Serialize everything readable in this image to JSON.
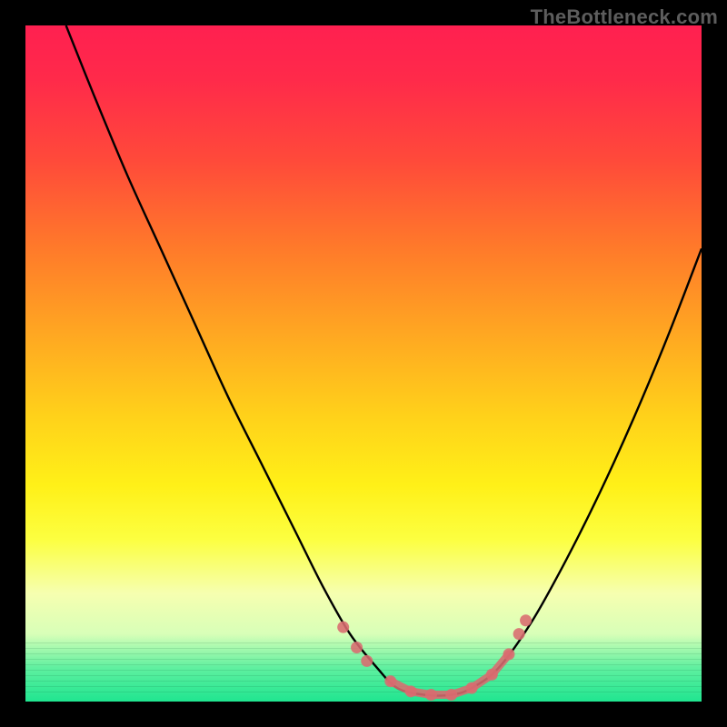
{
  "watermark": "TheBottleneck.com",
  "colors": {
    "frame": "#000000",
    "curve": "#000000",
    "marker": "#d96b70",
    "gradient_top": "#ff2050",
    "gradient_bottom": "#20e590"
  },
  "chart_data": {
    "type": "line",
    "title": "",
    "xlabel": "",
    "ylabel": "",
    "xlim": [
      0,
      100
    ],
    "ylim": [
      0,
      100
    ],
    "series": [
      {
        "name": "bottleneck-curve",
        "x": [
          6,
          10,
          15,
          20,
          25,
          30,
          35,
          40,
          44,
          48,
          52,
          55,
          59,
          63,
          66,
          70,
          75,
          80,
          85,
          90,
          95,
          100
        ],
        "y": [
          100,
          90,
          78,
          67,
          56,
          45,
          35,
          25,
          17,
          10,
          5,
          2,
          1,
          1,
          2,
          5,
          12,
          21,
          31,
          42,
          54,
          67
        ]
      }
    ],
    "markers": {
      "name": "highlighted-points",
      "points": [
        {
          "x": 47,
          "y": 11
        },
        {
          "x": 49,
          "y": 8
        },
        {
          "x": 50.5,
          "y": 6
        },
        {
          "x": 54,
          "y": 3
        },
        {
          "x": 57,
          "y": 1.5
        },
        {
          "x": 60,
          "y": 1
        },
        {
          "x": 63,
          "y": 1
        },
        {
          "x": 66,
          "y": 2
        },
        {
          "x": 69,
          "y": 4
        },
        {
          "x": 71.5,
          "y": 7
        },
        {
          "x": 73,
          "y": 10
        },
        {
          "x": 74,
          "y": 12
        }
      ]
    },
    "annotations": []
  }
}
